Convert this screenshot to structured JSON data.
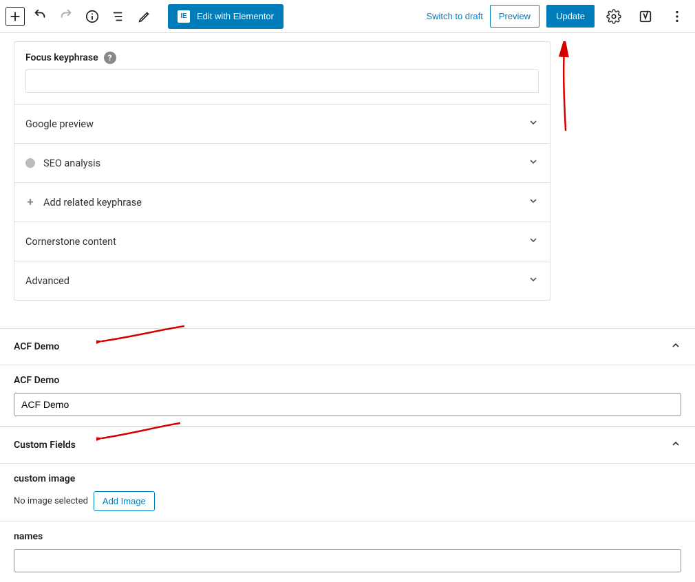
{
  "toolbar": {
    "elementor_label": "Edit with Elementor",
    "switch_draft": "Switch to draft",
    "preview": "Preview",
    "update": "Update"
  },
  "yoast": {
    "focus_keyphrase_label": "Focus keyphrase",
    "focus_keyphrase_value": "",
    "rows": {
      "google_preview": "Google preview",
      "seo_analysis": "SEO analysis",
      "add_related": "Add related keyphrase",
      "cornerstone": "Cornerstone content",
      "advanced": "Advanced"
    }
  },
  "acf": {
    "panel_title": "ACF Demo",
    "field_label": "ACF Demo",
    "field_value": "ACF Demo"
  },
  "custom_fields": {
    "panel_title": "Custom Fields",
    "custom_image_label": "custom image",
    "no_image_text": "No image selected",
    "add_image_label": "Add Image",
    "names_label": "names",
    "names_value": ""
  }
}
